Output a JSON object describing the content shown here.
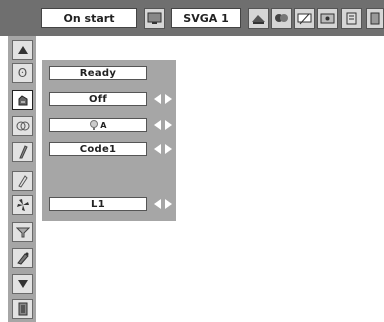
{
  "topbar": {
    "selection_label": "On start",
    "input_label": "SVGA 1",
    "icons": [
      "pc-adjust-icon",
      "picture-icon",
      "image-select-icon",
      "screen-icon",
      "setting-icon",
      "info-icon",
      "more-icon"
    ]
  },
  "sidebar": {
    "icons": [
      "scroll-up-icon",
      "language-icon",
      "menu-position-icon",
      "background-icon",
      "logo-icon",
      "security-icon",
      "fan-icon",
      "filter-icon",
      "lamp-icon",
      "scroll-down-icon",
      "exit-icon"
    ],
    "selected_index": 2
  },
  "panel": {
    "fields": [
      {
        "value": "Ready",
        "arrows": false
      },
      {
        "value": "Off",
        "arrows": true
      },
      {
        "value": "A",
        "icon": "lens-shift-icon",
        "arrows": true
      },
      {
        "value": "Code1",
        "arrows": true
      },
      {
        "value": "L1",
        "arrows": true
      }
    ]
  }
}
